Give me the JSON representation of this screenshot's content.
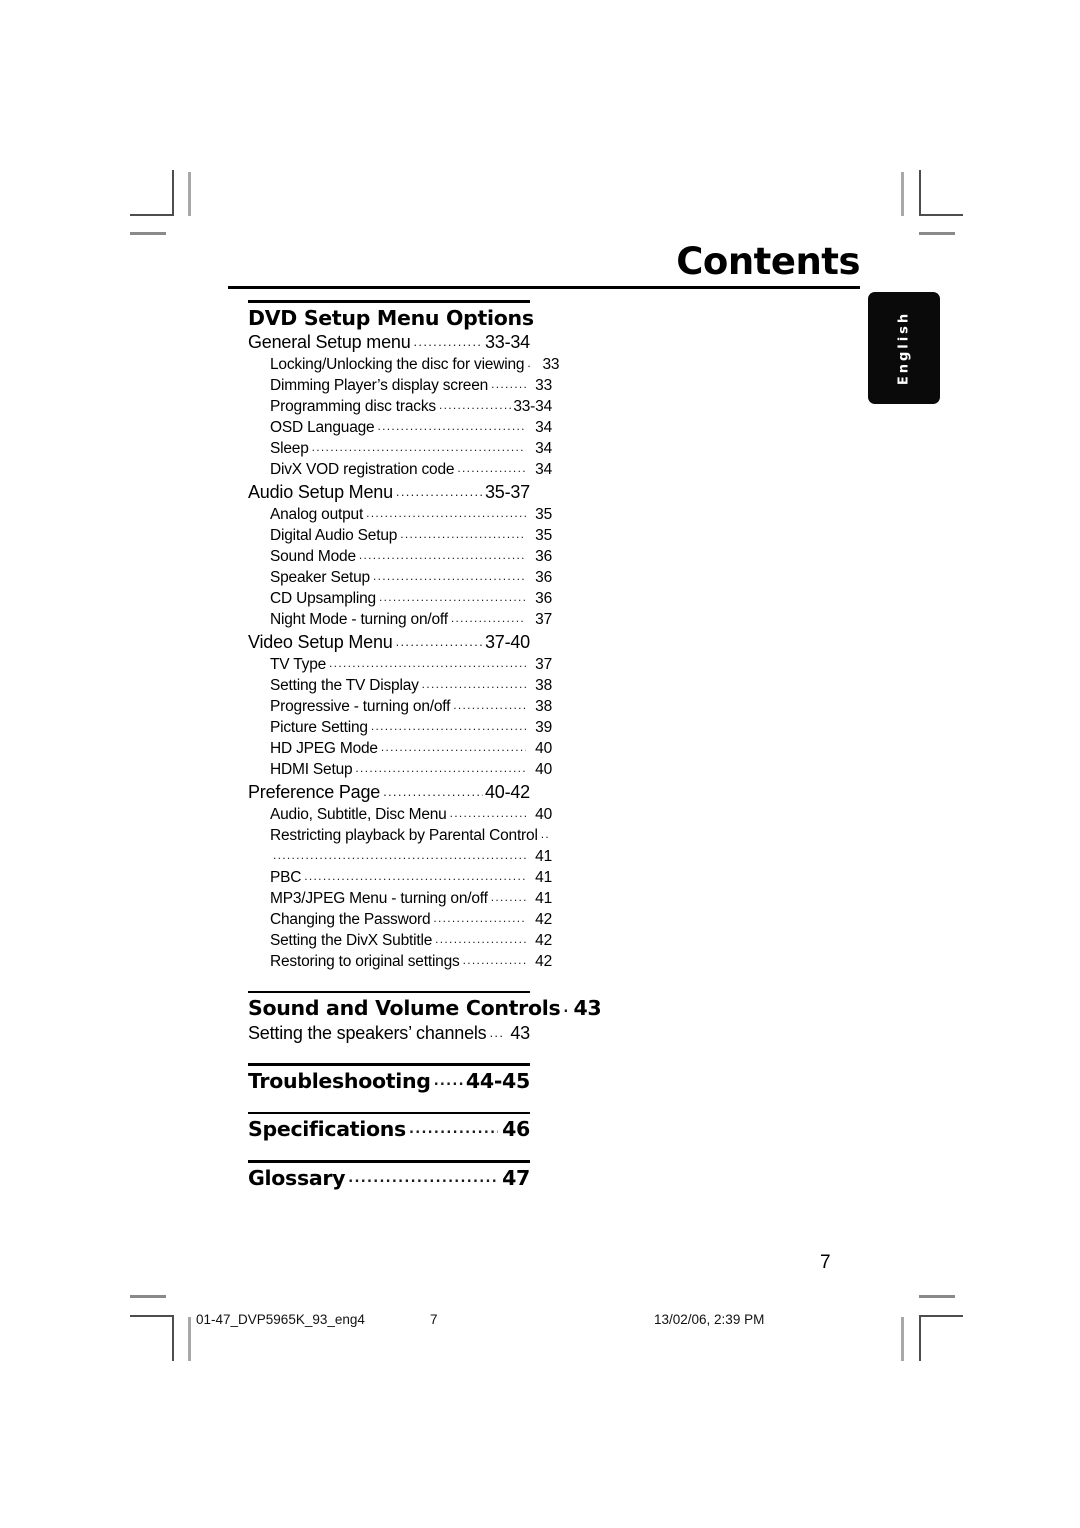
{
  "header": {
    "title": "Contents"
  },
  "side_tab": {
    "label": "English"
  },
  "toc": {
    "sections": [
      {
        "heading": {
          "text": "DVD Setup Menu Options",
          "page": ""
        },
        "entries": [
          {
            "level": 1,
            "text": "General Setup menu",
            "page": "33-34"
          },
          {
            "level": 2,
            "text": "Locking/Unlocking the disc for viewing",
            "page": "33"
          },
          {
            "level": 2,
            "text": "Dimming Player’s display screen",
            "page": "33"
          },
          {
            "level": 2,
            "text": "Programming disc tracks",
            "page": "33-34"
          },
          {
            "level": 2,
            "text": "OSD Language",
            "page": "34"
          },
          {
            "level": 2,
            "text": "Sleep",
            "page": "34"
          },
          {
            "level": 2,
            "text": "DivX VOD registration code",
            "page": "34"
          },
          {
            "level": 1,
            "text": "Audio Setup Menu",
            "page": "35-37"
          },
          {
            "level": 2,
            "text": "Analog output",
            "page": "35"
          },
          {
            "level": 2,
            "text": "Digital Audio Setup",
            "page": "35"
          },
          {
            "level": 2,
            "text": "Sound Mode",
            "page": "36"
          },
          {
            "level": 2,
            "text": "Speaker Setup",
            "page": "36"
          },
          {
            "level": 2,
            "text": "CD Upsampling",
            "page": "36"
          },
          {
            "level": 2,
            "text": "Night Mode - turning on/off",
            "page": "37"
          },
          {
            "level": 1,
            "text": "Video Setup Menu",
            "page": "37-40"
          },
          {
            "level": 2,
            "text": "TV Type",
            "page": "37"
          },
          {
            "level": 2,
            "text": "Setting the TV Display",
            "page": "38"
          },
          {
            "level": 2,
            "text": "Progressive - turning on/off",
            "page": "38"
          },
          {
            "level": 2,
            "text": "Picture Setting",
            "page": "39"
          },
          {
            "level": 2,
            "text": "HD JPEG Mode",
            "page": "40"
          },
          {
            "level": 2,
            "text": "HDMI Setup",
            "page": "40"
          },
          {
            "level": 1,
            "text": "Preference Page",
            "page": "40-42"
          },
          {
            "level": 2,
            "text": "Audio, Subtitle, Disc Menu",
            "page": "40"
          },
          {
            "level": 2,
            "text": "Restricting playback by Parental Control",
            "page": "41",
            "wrapped": true
          },
          {
            "level": 2,
            "text": "PBC",
            "page": "41"
          },
          {
            "level": 2,
            "text": "MP3/JPEG Menu - turning on/off",
            "page": "41"
          },
          {
            "level": 2,
            "text": "Changing the Password",
            "page": "42"
          },
          {
            "level": 2,
            "text": "Setting the DivX Subtitle",
            "page": "42"
          },
          {
            "level": 2,
            "text": "Restoring to original settings",
            "page": "42"
          }
        ]
      },
      {
        "heading": {
          "text": "Sound and Volume Controls",
          "page": "43"
        },
        "entries": [
          {
            "level": 1,
            "text": "Setting the speakers’ channels",
            "page": "43"
          }
        ]
      },
      {
        "heading": {
          "text": "Troubleshooting",
          "page": "44-45"
        },
        "entries": []
      },
      {
        "heading": {
          "text": "Specifications",
          "page": "46"
        },
        "entries": []
      },
      {
        "heading": {
          "text": "Glossary",
          "page": "47"
        },
        "entries": []
      }
    ]
  },
  "folio": "7",
  "footer": {
    "file": "01-47_DVP5965K_93_eng4",
    "page": "7",
    "timestamp": "13/02/06, 2:39 PM"
  }
}
